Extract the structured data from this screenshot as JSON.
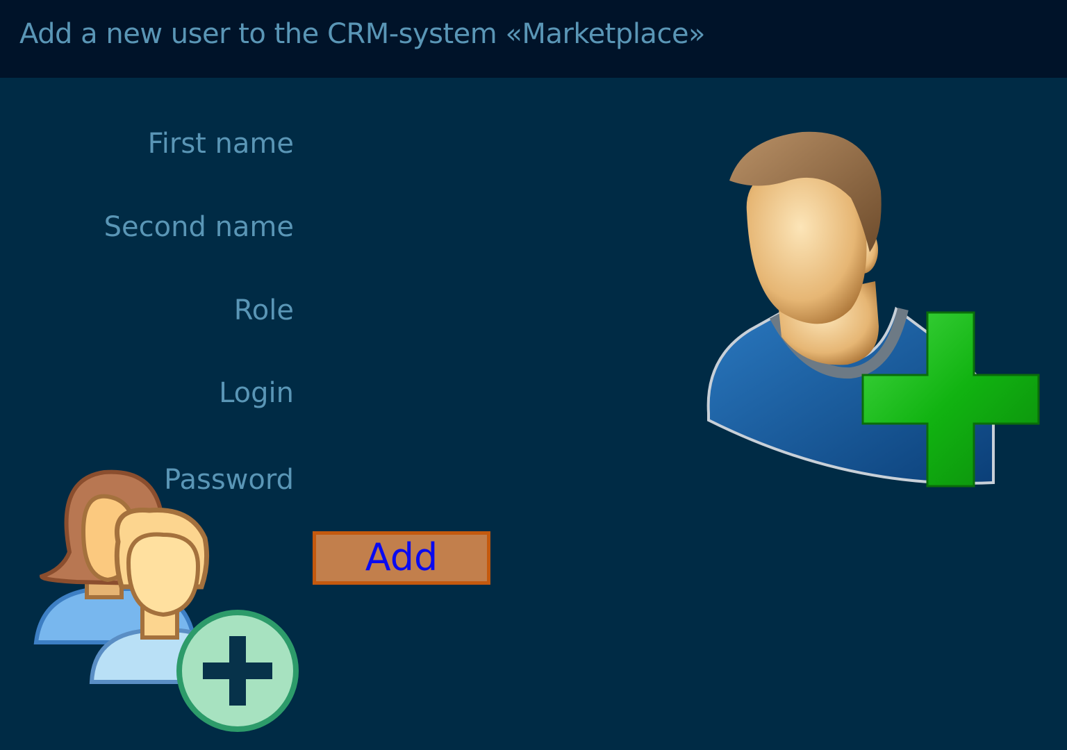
{
  "header": {
    "title": "Add a new user to the CRM-system «Marketplace»"
  },
  "form": {
    "labels": {
      "first_name": "First name",
      "second_name": "Second name",
      "role": "Role",
      "login": "Login",
      "password": "Password"
    },
    "add_button_label": "Add"
  },
  "icons": {
    "large_illustration": "user-add-icon",
    "small_illustration": "users-group-add-icon"
  },
  "colors": {
    "background": "#002b45",
    "header_background": "#001329",
    "label_text": "#5a96b6",
    "button_fill": "#c27f4c",
    "button_border": "#c4590e",
    "button_text": "#0a0af0",
    "plus_green": "#1fb31f"
  }
}
